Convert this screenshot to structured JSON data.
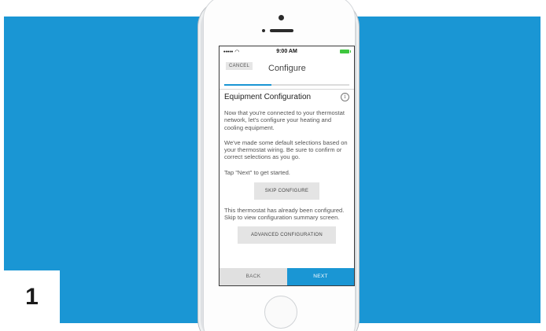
{
  "step_number": "1",
  "colors": {
    "background_band": "#1a96d4",
    "accent": "#1a96d4",
    "battery": "#3ec63e"
  },
  "status_bar": {
    "signal": "•••••",
    "wifi_icon": "wifi-icon",
    "time": "9:00 AM",
    "battery_icon": "battery-icon"
  },
  "nav": {
    "cancel_label": "CANCEL",
    "title": "Configure"
  },
  "progress": {
    "fraction": 0.38
  },
  "section": {
    "title": "Equipment Configuration",
    "info_icon": "info-icon",
    "paragraph_1": "Now that you're connected to your thermostat network, let's configure your heating and cooling equipment.",
    "paragraph_2": "We've made some default selections based on your thermostat wiring. Be sure to confirm or correct selections as you go.",
    "paragraph_3": "Tap \"Next\" to get started.",
    "skip_label": "SKIP CONFIGURE",
    "paragraph_4": "This thermostat has already been configured. Skip to view configuration summary screen.",
    "advanced_label": "ADVANCED CONFIGURATION"
  },
  "footer": {
    "back_label": "BACK",
    "next_label": "NEXT"
  }
}
